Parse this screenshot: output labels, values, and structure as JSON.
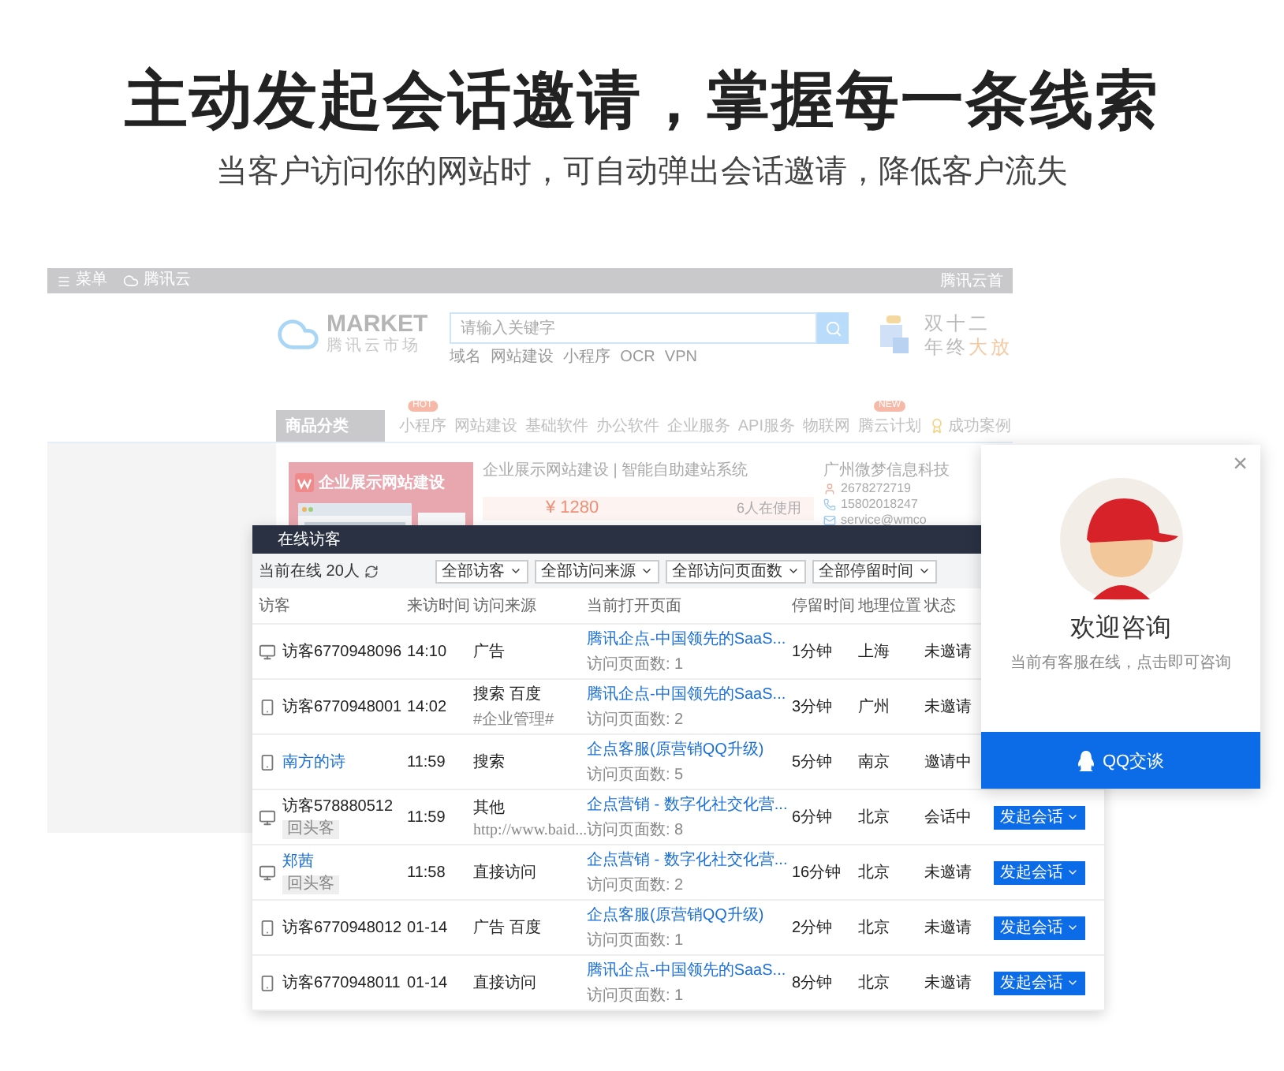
{
  "headline": "主动发起会话邀请，掌握每一条线索",
  "subheadline": "当客户访问你的网站时，可自动弹出会话邀请，降低客户流失",
  "website": {
    "top_bar": {
      "menu_label": "菜单",
      "brand": "腾讯云",
      "right_link": "腾讯云首"
    },
    "logo": {
      "title": "MARKET",
      "subtitle": "腾讯云市场"
    },
    "search": {
      "placeholder": "请输入关键字",
      "hot_links": [
        "域名",
        "网站建设",
        "小程序",
        "OCR",
        "VPN"
      ]
    },
    "promo": {
      "line_1": "双十二",
      "line_2": "年终",
      "line_2_highlight": "大放"
    },
    "category_label": "商品分类",
    "nav": [
      {
        "label": "小程序",
        "badge": "HOT",
        "kind": "link"
      },
      {
        "label": "网站建设",
        "kind": "link"
      },
      {
        "label": "基础软件",
        "kind": "link"
      },
      {
        "label": "办公软件",
        "kind": "link"
      },
      {
        "label": "企业服务",
        "kind": "link"
      },
      {
        "label": "API服务",
        "kind": "link"
      },
      {
        "label": "物联网",
        "kind": "link"
      },
      {
        "label": "腾云计划",
        "badge": "NEW",
        "kind": "link"
      },
      {
        "label": "成功案例",
        "kind": "case"
      }
    ],
    "product": {
      "banner_title": "企业展示网站建设",
      "title": "企业展示网站建设 | 智能自助建站系统",
      "price": "¥ 1280",
      "users": "6人在使用"
    },
    "vendor": {
      "name": "广州微梦信息科技",
      "qq": "2678272719",
      "phone": "15802018247",
      "email": "service@wmco"
    }
  },
  "visitors_panel": {
    "title": "在线访客",
    "online": "当前在线 20人",
    "filters": [
      "全部访客",
      "全部访问来源",
      "全部访问页面数",
      "全部停留时间"
    ],
    "columns": [
      "访客",
      "来访时间",
      "访问来源",
      "当前打开页面",
      "停留时间",
      "地理位置",
      "状态"
    ],
    "rows": [
      {
        "kind": "desktop",
        "visitor": "访客6770948096",
        "is_contact": false,
        "time": "14:10",
        "source": "广告",
        "page": "腾讯企点-中国领先的SaaS...",
        "page_views": "访问页面数: 1",
        "duration": "1分钟",
        "location": "上海",
        "status": "未邀请"
      },
      {
        "kind": "mobile",
        "visitor": "访客6770948001",
        "is_contact": false,
        "time": "14:02",
        "source": "搜索 百度",
        "source_detail": "#企业管理#",
        "page": "腾讯企点-中国领先的SaaS...",
        "page_views": "访问页面数: 2",
        "duration": "3分钟",
        "location": "广州",
        "status": "未邀请"
      },
      {
        "kind": "mobile",
        "visitor": "南方的诗",
        "is_contact": true,
        "time": "11:59",
        "source": "搜索",
        "page": "企点客服(原营销QQ升级)",
        "page_views": "访问页面数: 5",
        "duration": "5分钟",
        "location": "南京",
        "status": "邀请中"
      },
      {
        "kind": "desktop",
        "visitor": "访客578880512",
        "is_contact": false,
        "tag": "回头客",
        "time": "11:59",
        "source": "其他",
        "source_detail": "http://www.baid...",
        "page": "企点营销 - 数字化社交化营...",
        "page_views": "访问页面数: 8",
        "duration": "6分钟",
        "location": "北京",
        "status": "会话中",
        "action": "发起会话"
      },
      {
        "kind": "desktop",
        "visitor": "郑茜",
        "is_contact": true,
        "tag": "回头客",
        "time": "11:58",
        "source": "直接访问",
        "page": "企点营销 - 数字化社交化营...",
        "page_views": "访问页面数: 2",
        "duration": "16分钟",
        "location": "北京",
        "status": "未邀请",
        "action": "发起会话"
      },
      {
        "kind": "mobile",
        "visitor": "访客6770948012",
        "is_contact": false,
        "time": "01-14",
        "source": "广告 百度",
        "page": "企点客服(原营销QQ升级)",
        "page_views": "访问页面数: 1",
        "duration": "2分钟",
        "location": "北京",
        "status": "未邀请",
        "action": "发起会话"
      },
      {
        "kind": "mobile",
        "visitor": "访客6770948011",
        "is_contact": false,
        "time": "01-14",
        "source": "直接访问",
        "page": "腾讯企点-中国领先的SaaS...",
        "page_views": "访问页面数: 1",
        "duration": "8分钟",
        "location": "北京",
        "status": "未邀请",
        "action": "发起会话"
      }
    ]
  },
  "chat_popup": {
    "close": "×",
    "title": "欢迎咨询",
    "message": "当前有客服在线，点击即可咨询",
    "button": "QQ交谈"
  }
}
